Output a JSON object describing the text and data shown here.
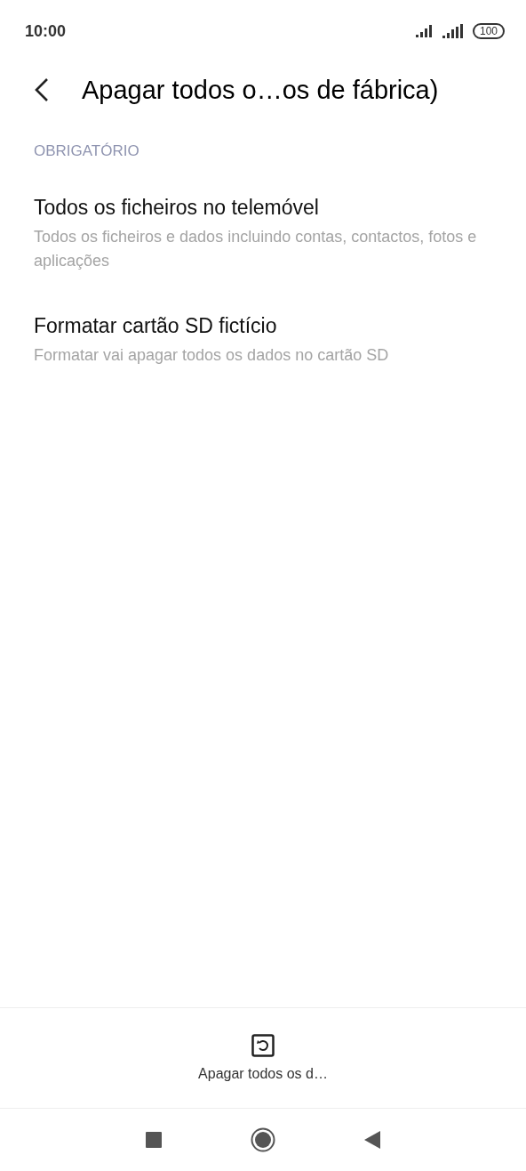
{
  "status_bar": {
    "time": "10:00",
    "battery": "100"
  },
  "header": {
    "title": "Apagar todos o…os de fábrica)"
  },
  "section": {
    "label": "OBRIGATÓRIO",
    "items": [
      {
        "title": "Todos os ficheiros no telemóvel",
        "subtitle": "Todos os ficheiros e dados incluindo contas, contactos, fotos e aplicações"
      },
      {
        "title": "Formatar cartão SD fictício",
        "subtitle": "Formatar vai apagar todos os dados no cartão SD"
      }
    ]
  },
  "action": {
    "label": "Apagar todos os d…"
  }
}
